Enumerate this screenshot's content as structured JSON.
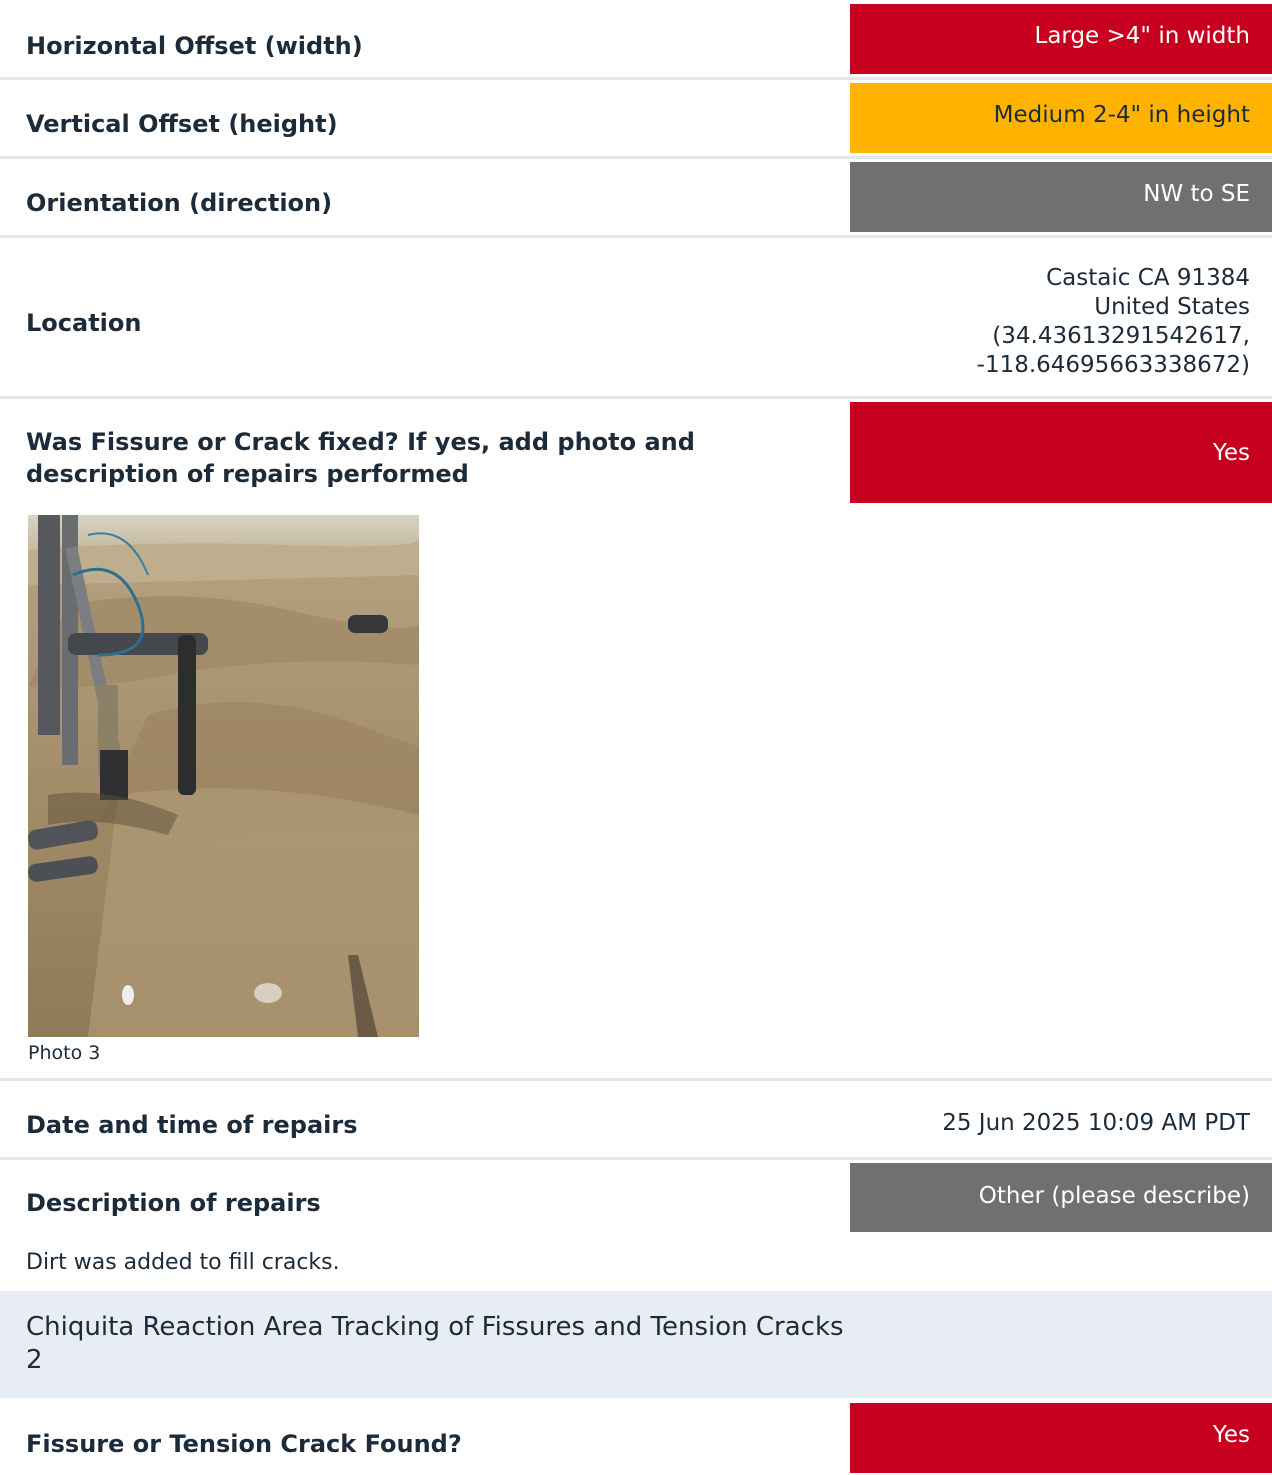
{
  "rows": {
    "horizontal_offset": {
      "label": "Horizontal Offset (width)",
      "value": "Large >4\" in width",
      "color": "#c8001f"
    },
    "vertical_offset": {
      "label": "Vertical Offset (height)",
      "value": "Medium 2-4\" in height",
      "color": "#ffb300"
    },
    "orientation": {
      "label": "Orientation (direction)",
      "value": "NW to SE",
      "color": "#707070"
    },
    "location": {
      "label": "Location",
      "line1": "Castaic CA 91384",
      "line2": "United States",
      "line3": "(34.43613291542617,",
      "line4": "-118.64695663338672)"
    },
    "fixed": {
      "label": "Was Fissure or Crack fixed? If yes, add photo and description of repairs performed",
      "value": "Yes",
      "color": "#c8001f"
    },
    "photo": {
      "caption": "Photo 3"
    },
    "date_time": {
      "label": "Date and time of repairs",
      "value": "25 Jun 2025 10:09 AM PDT"
    },
    "description": {
      "label": "Description of repairs",
      "value": "Other (please describe)",
      "color": "#707070",
      "text": "Dirt was added to fill cracks."
    }
  },
  "section": {
    "title": "Chiquita Reaction Area Tracking of Fissures and Tension Cracks 2"
  },
  "found": {
    "label": "Fissure or Tension Crack Found?",
    "value": "Yes",
    "color": "#c8001f"
  }
}
